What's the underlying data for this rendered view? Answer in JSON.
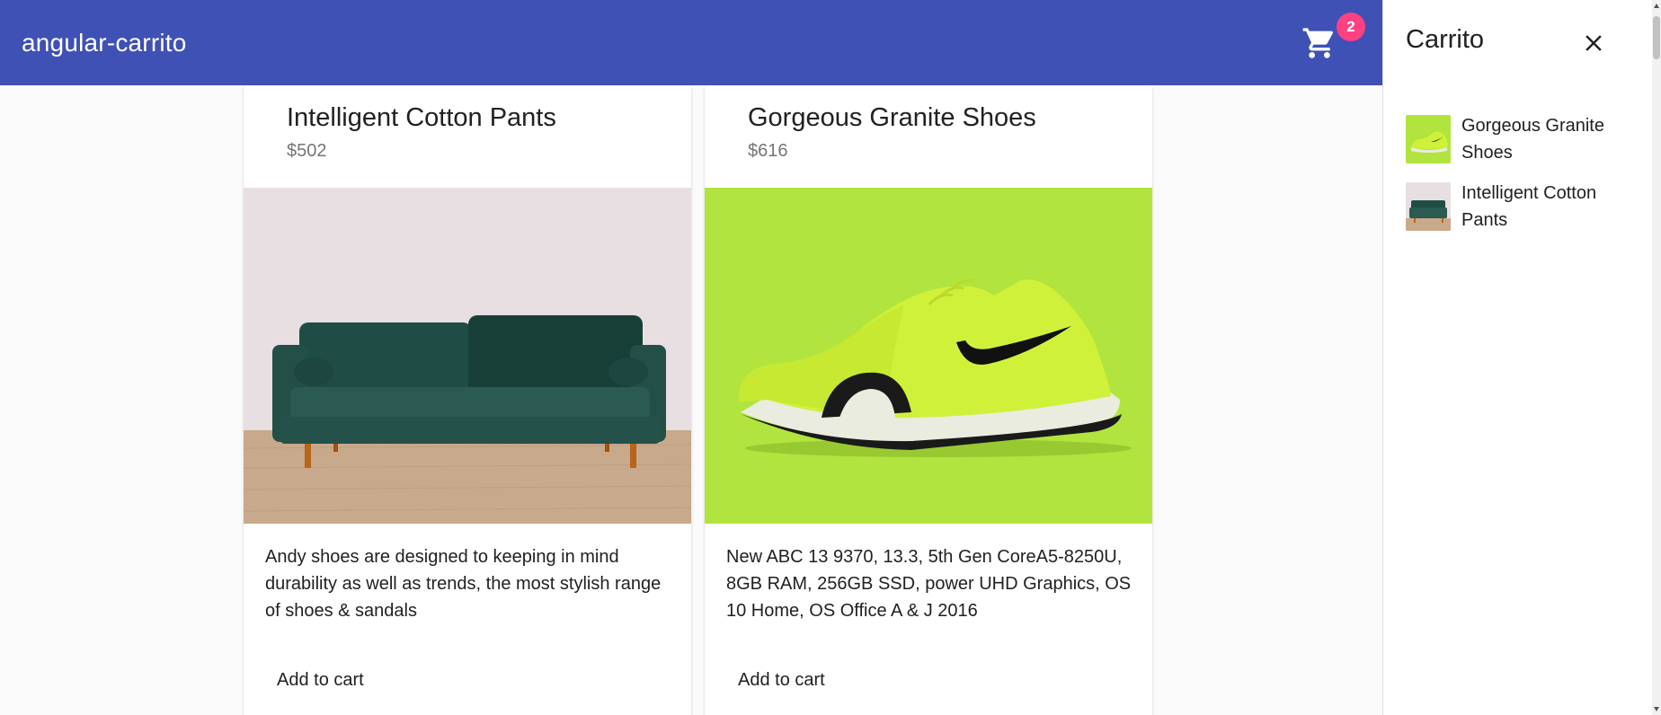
{
  "toolbar": {
    "title": "angular-carrito",
    "cart_icon": "shopping-cart-icon",
    "cart_count": "2",
    "background": "#3f51b5",
    "badge_color": "#ff4081"
  },
  "products": [
    {
      "title": "Intelligent Cotton Pants",
      "price": "$502",
      "image": "green-velvet-sofa",
      "description": "Andy shoes are designed to keeping in mind durability as well as trends, the most stylish range of shoes & sandals",
      "button_label": "Add to cart"
    },
    {
      "title": "Gorgeous Granite Shoes",
      "price": "$616",
      "image": "neon-green-sneaker",
      "description": "New ABC 13 9370, 13.3, 5th Gen CoreA5-8250U, 8GB RAM, 256GB SSD, power UHD Graphics, OS 10 Home, OS Office A & J 2016",
      "button_label": "Add to cart"
    }
  ],
  "sidebar": {
    "title": "Carrito",
    "close_icon": "close-icon",
    "items": [
      {
        "name": "Gorgeous Granite Shoes",
        "thumb": "neon-green-sneaker"
      },
      {
        "name": "Intelligent Cotton Pants",
        "thumb": "green-velvet-sofa"
      }
    ]
  }
}
